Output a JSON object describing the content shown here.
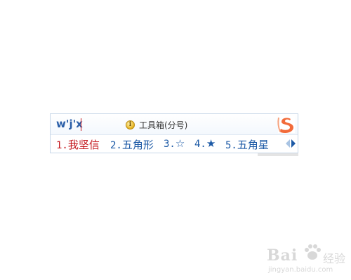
{
  "ime": {
    "composition": "w'j'x",
    "hint": "工具箱(分号)",
    "candidates": [
      {
        "num": "1.",
        "text": "我坚信"
      },
      {
        "num": "2.",
        "text": "五角形"
      },
      {
        "num": "3.",
        "text": "☆"
      },
      {
        "num": "4.",
        "text": "★"
      },
      {
        "num": "5.",
        "text": "五角星"
      }
    ],
    "colors": {
      "selected": "#c4161c",
      "candidate": "#1d5aa6",
      "composition": "#2b5fa8",
      "logo": "#f26b3a"
    },
    "icons": {
      "info": "info-icon",
      "logo": "sogou-logo-icon",
      "prev": "prev-page-arrow-icon",
      "next": "next-page-arrow-icon"
    }
  },
  "watermark": {
    "brand": "Bai",
    "suffix": "经验",
    "url": "jingyan.baidu.com"
  }
}
